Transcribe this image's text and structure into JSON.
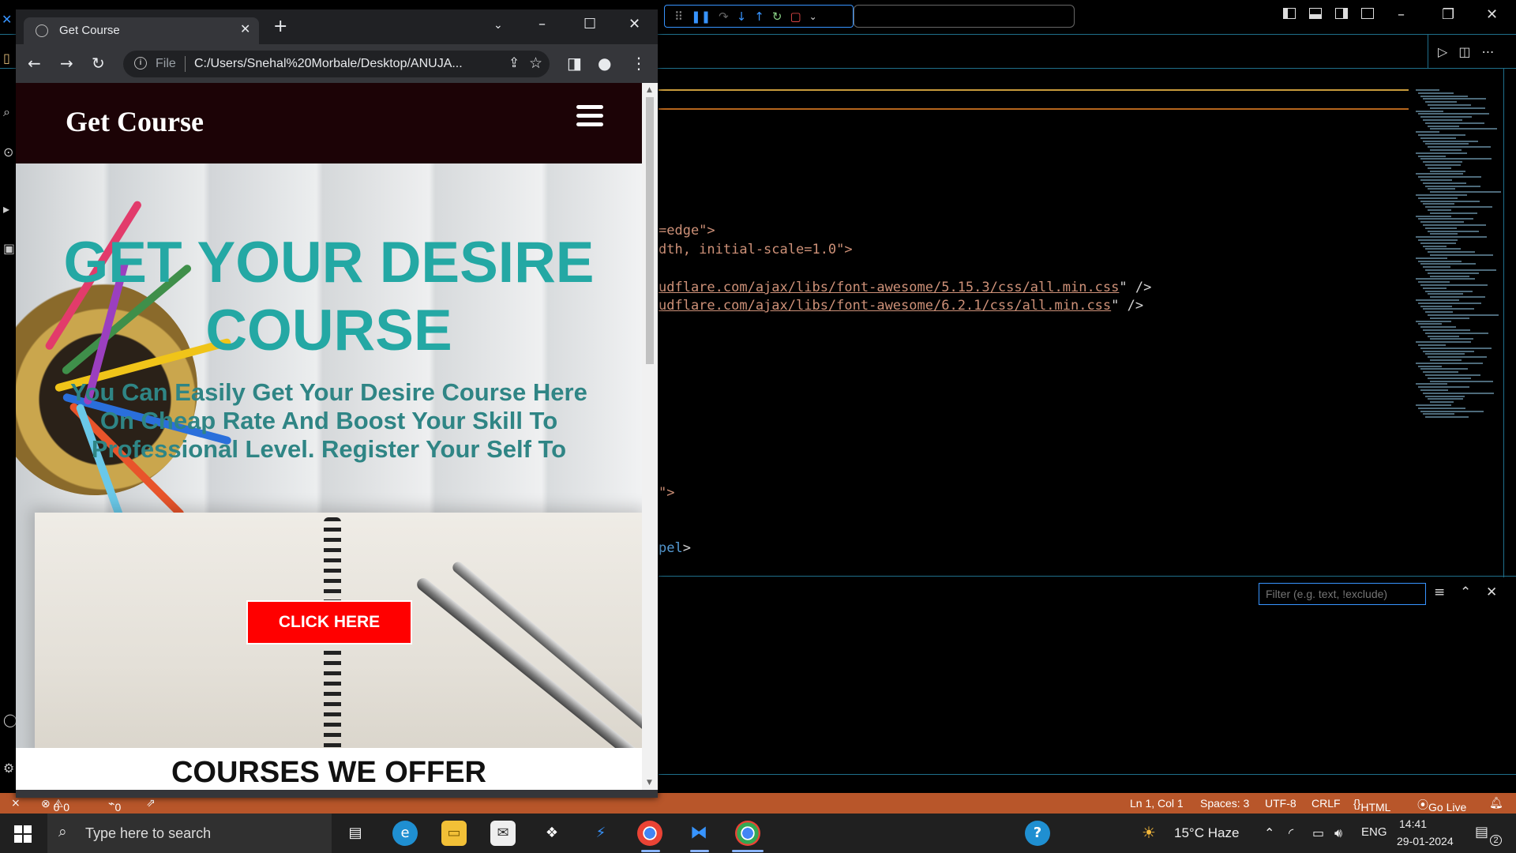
{
  "browser": {
    "tab_title": "Get Course",
    "new_tab_symbol": "+",
    "omnibox": {
      "scheme_label": "File",
      "url": "C:/Users/Snehal%20Morbale/Desktop/ANUJA..."
    }
  },
  "site": {
    "logo": "Get Course",
    "hero_title": "GET YOUR DESIRE COURSE",
    "hero_subtitle": "You Can Easily Get Your Desire Course Here On Cheap Rate And Boost Your Skill To Professional Level. Register Your Self To",
    "cta_label": "CLICK HERE",
    "section_title": "COURSES WE OFFER"
  },
  "vscode": {
    "code_lines": [
      {
        "text": "=edge\">"
      },
      {
        "text": "dth, initial-scale=1.0\">"
      },
      {
        "url": "udflare.com/ajax/libs/font-awesome/5.15.3/css/all.min.css",
        "tail": "\" />"
      },
      {
        "url": "udflare.com/ajax/libs/font-awesome/6.2.1/css/all.min.css",
        "tail": "\" />"
      },
      {
        "text": "\">"
      },
      {
        "tag": "pel",
        "tail": ">"
      }
    ],
    "filter_placeholder": "Filter (e.g. text, !exclude)",
    "status": {
      "errors": "0",
      "warnings": "0",
      "ports": "0",
      "position": "Ln 1, Col 1",
      "spaces": "Spaces: 3",
      "encoding": "UTF-8",
      "eol": "CRLF",
      "language": "HTML",
      "go_live": "Go Live"
    }
  },
  "taskbar": {
    "search_placeholder": "Type here to search",
    "weather": "15°C  Haze",
    "language": "ENG",
    "time": "14:41",
    "date": "29-01-2024",
    "notifications": "2"
  },
  "colors": {
    "hero_title": "#24a8a4",
    "hero_subtitle": "#2f8585",
    "cta_bg": "#ff0000",
    "header_bg": "#1c0306",
    "statusbar_bg": "#b8562a"
  }
}
